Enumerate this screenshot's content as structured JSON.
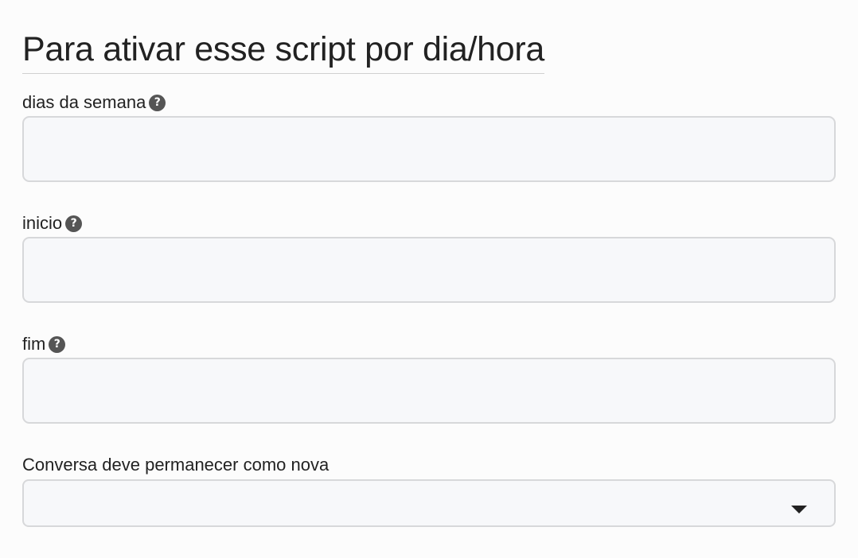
{
  "section": {
    "title": "Para ativar esse script por dia/hora"
  },
  "fields": {
    "dias_da_semana": {
      "label": "dias da semana",
      "value": "",
      "help_icon": "question-circle-icon"
    },
    "inicio": {
      "label": "inicio",
      "value": "",
      "help_icon": "question-circle-icon"
    },
    "fim": {
      "label": "fim",
      "value": "",
      "help_icon": "question-circle-icon"
    },
    "conversa_nova": {
      "label": "Conversa deve permanecer como nova",
      "selected": "",
      "dropdown_icon": "caret-down-icon"
    }
  },
  "colors": {
    "help_icon_bg": "#555555",
    "input_bg": "#f7f8fa",
    "input_border": "#d7d8da",
    "text": "#222222"
  }
}
